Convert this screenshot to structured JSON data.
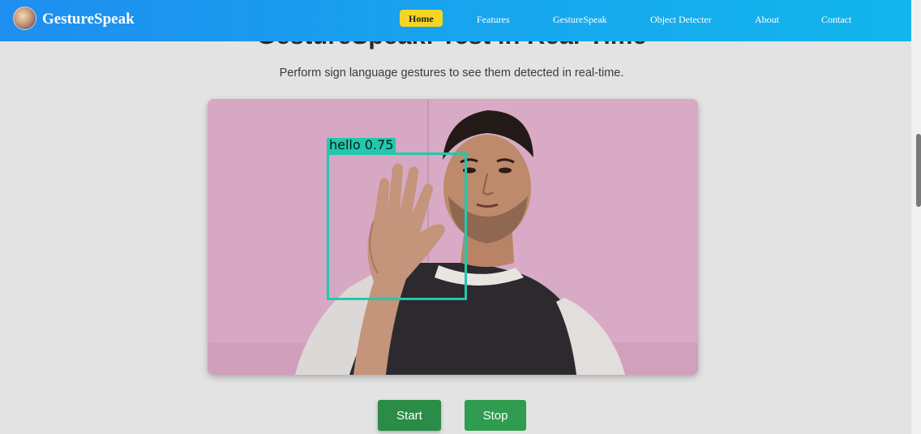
{
  "navbar": {
    "brand": "GestureSpeak",
    "items": [
      {
        "label": "Home",
        "active": true
      },
      {
        "label": "Features"
      },
      {
        "label": "GestureSpeak"
      },
      {
        "label": "Object Detecter"
      },
      {
        "label": "About"
      },
      {
        "label": "Contact"
      }
    ],
    "colors": {
      "start": "#1e8ef0",
      "end": "#12b6ec",
      "active": "#f5d523"
    }
  },
  "page": {
    "title": "GestureSpeak: Test in Real-Time",
    "subtitle": "Perform sign language gestures to see them detected in real-time."
  },
  "video": {
    "detection_label": "hello  0.75",
    "box_color": "#22c8ae"
  },
  "controls": {
    "start_label": "Start",
    "stop_label": "Stop",
    "button_color": "#2a8c46"
  }
}
